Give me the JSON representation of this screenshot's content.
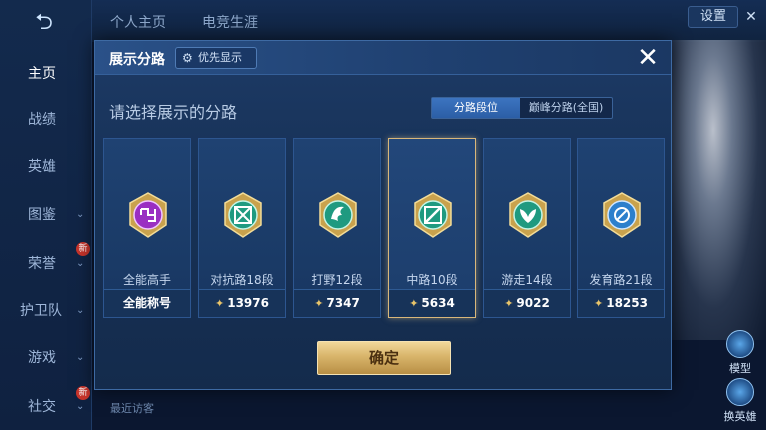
{
  "background": {
    "back_icon": "back-arrow-icon",
    "sidebar": [
      {
        "label": "主页",
        "active": true
      },
      {
        "label": "战绩",
        "active": false
      },
      {
        "label": "英雄",
        "active": false
      },
      {
        "label": "图鉴",
        "active": false
      },
      {
        "label": "荣誉",
        "active": false
      },
      {
        "label": "护卫队",
        "active": false
      },
      {
        "label": "游戏",
        "active": false
      },
      {
        "label": "社交",
        "active": false
      }
    ],
    "sidebar_badges": [
      "新",
      "新"
    ],
    "tabs": [
      "个人主页",
      "电竞生涯"
    ],
    "settings_label": "设置",
    "right_buttons": [
      "模型",
      "换英雄"
    ],
    "bottom_text": "最近访客"
  },
  "modal": {
    "title": "展示分路",
    "priority_label": "优先显示",
    "close_icon": "close-x-icon",
    "prompt": "请选择展示的分路",
    "toggle": {
      "options": [
        "分路段位",
        "巅峰分路(全国)"
      ],
      "active_index": 0
    },
    "cards": [
      {
        "label": "全能高手",
        "footer": "全能称号",
        "has_coin": false,
        "emblem_color": "#b445d6",
        "selected": false
      },
      {
        "label": "对抗路18段",
        "footer": "13976",
        "has_coin": true,
        "emblem_color": "#2fb59a",
        "selected": false
      },
      {
        "label": "打野12段",
        "footer": "7347",
        "has_coin": true,
        "emblem_color": "#2fb59a",
        "selected": false
      },
      {
        "label": "中路10段",
        "footer": "5634",
        "has_coin": true,
        "emblem_color": "#2fb59a",
        "selected": true
      },
      {
        "label": "游走14段",
        "footer": "9022",
        "has_coin": true,
        "emblem_color": "#2fb59a",
        "selected": false
      },
      {
        "label": "发育路21段",
        "footer": "18253",
        "has_coin": true,
        "emblem_color": "#3a8fd8",
        "selected": false
      }
    ],
    "confirm_label": "确定"
  }
}
